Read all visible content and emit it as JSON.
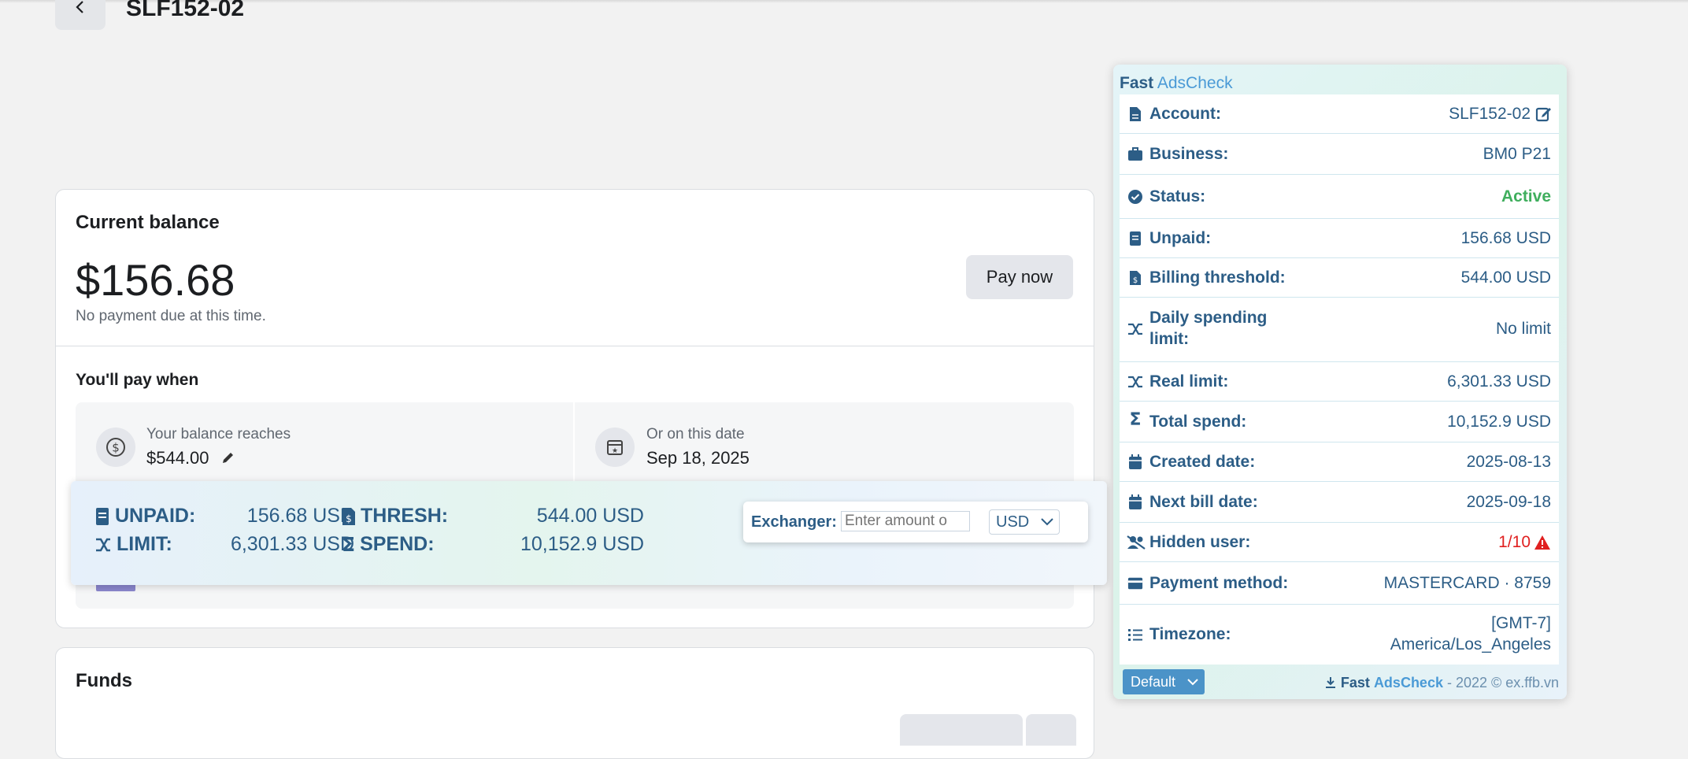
{
  "header": {
    "title": "SLF152-02"
  },
  "balance_card": {
    "heading": "Current balance",
    "amount": "$156.68",
    "note": "No payment due at this time.",
    "pay_button": "Pay now",
    "pay_when_heading": "You'll pay when",
    "threshold_label": "Your balance reaches",
    "threshold_value": "$544.00",
    "date_label": "Or on this date",
    "date_value": "Sep 18, 2025"
  },
  "funds_card": {
    "heading": "Funds"
  },
  "overlay": {
    "unpaid_label": "UNPAID:",
    "unpaid_value": "156.68 USD",
    "thresh_label": "THRESH:",
    "thresh_value": "544.00 USD",
    "limit_label": "LIMIT:",
    "limit_value": "6,301.33 USD",
    "spend_label": "SPEND:",
    "spend_value": "10,152.9 USD",
    "exchanger_label": "Exchanger:",
    "exchanger_placeholder": "Enter amount o",
    "currency": "USD"
  },
  "panel": {
    "brand_a": "Fast",
    "brand_b": "AdsCheck",
    "rows": [
      {
        "label": "Account:",
        "value": "SLF152-02"
      },
      {
        "label": "Business:",
        "value": "BM0 P21"
      },
      {
        "label": "Status:",
        "value": "Active"
      },
      {
        "label": "Unpaid:",
        "value": "156.68 USD"
      },
      {
        "label": "Billing threshold:",
        "value": "544.00 USD"
      },
      {
        "label": "Daily spending limit:",
        "value": "No limit"
      },
      {
        "label": "Real limit:",
        "value": "6,301.33 USD"
      },
      {
        "label": "Total spend:",
        "value": "10,152.9 USD"
      },
      {
        "label": "Created date:",
        "value": "2025-08-13"
      },
      {
        "label": "Next bill date:",
        "value": "2025-09-18"
      },
      {
        "label": "Hidden user:",
        "value": "1/10"
      },
      {
        "label": "Payment method:",
        "value": "MASTERCARD · 8759"
      },
      {
        "label": "Timezone:",
        "value": "[GMT-7] America/Los_Angeles"
      }
    ],
    "footer_select": "Default",
    "footer_brand_a": "Fast",
    "footer_brand_b": "AdsCheck",
    "footer_text": "- 2022 © ex.ffb.vn"
  },
  "colors": {
    "accent": "#2c5d86",
    "active": "#3fae5d",
    "warning": "#e02020"
  }
}
